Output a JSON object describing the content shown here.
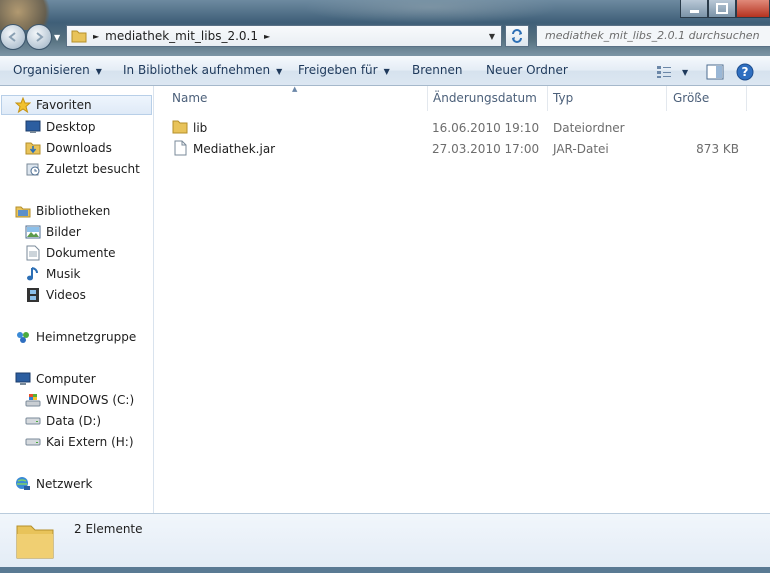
{
  "window": {
    "controls": {
      "minimize": "minimize",
      "maximize": "maximize",
      "close": "close"
    }
  },
  "address": {
    "path": [
      "mediathek_mit_libs_2.0.1"
    ],
    "search_placeholder": "mediathek_mit_libs_2.0.1 durchsuchen"
  },
  "toolbar": {
    "organize": "Organisieren",
    "include_library": "In Bibliothek aufnehmen",
    "share": "Freigeben für",
    "burn": "Brennen",
    "new_folder": "Neuer Ordner"
  },
  "nav": {
    "favorites": "Favoriten",
    "desktop": "Desktop",
    "downloads": "Downloads",
    "recent": "Zuletzt besucht",
    "libraries": "Bibliotheken",
    "pictures": "Bilder",
    "documents": "Dokumente",
    "music": "Musik",
    "videos": "Videos",
    "homegroup": "Heimnetzgruppe",
    "computer": "Computer",
    "drive_c": "WINDOWS (C:)",
    "drive_d": "Data (D:)",
    "drive_h": "Kai Extern (H:)",
    "network": "Netzwerk"
  },
  "columns": {
    "name": "Name",
    "modified": "Änderungsdatum",
    "type": "Typ",
    "size": "Größe"
  },
  "files": [
    {
      "name": "lib",
      "modified": "16.06.2010 19:10",
      "type": "Dateiordner",
      "size": ""
    },
    {
      "name": "Mediathek.jar",
      "modified": "27.03.2010 17:00",
      "type": "JAR-Datei",
      "size": "873 KB"
    }
  ],
  "status": {
    "count": "2 Elemente"
  },
  "colors": {
    "accent": "#1e395b",
    "folder": "#e8c35a"
  }
}
